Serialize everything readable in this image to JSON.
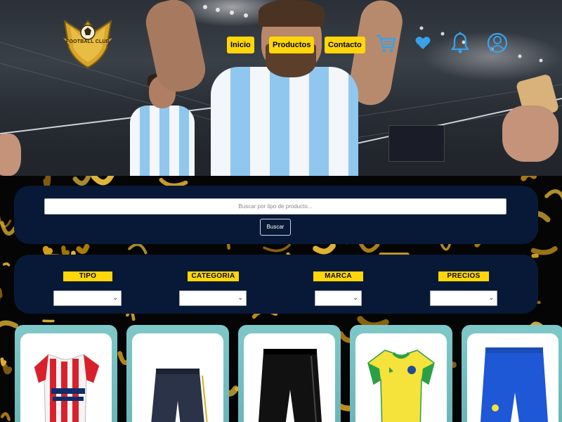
{
  "brand": {
    "logo_text": "FOOTBALL CLUB"
  },
  "nav": {
    "items": [
      {
        "label": "Inicio"
      },
      {
        "label": "Productos"
      },
      {
        "label": "Contacto"
      }
    ],
    "icons": [
      "cart-icon",
      "heart-icon",
      "bell-icon",
      "user-icon"
    ]
  },
  "search": {
    "placeholder": "Buscar por tipo de producto...",
    "button_label": "Buscar"
  },
  "filters": [
    {
      "label": "TIPO",
      "value": ""
    },
    {
      "label": "CATEGORIA",
      "value": ""
    },
    {
      "label": "MARCA",
      "value": ""
    },
    {
      "label": "PRECIOS",
      "value": ""
    }
  ],
  "products": [
    {
      "image": "red-white-striped-jersey"
    },
    {
      "image": "navy-shorts"
    },
    {
      "image": "black-shorts"
    },
    {
      "image": "yellow-brazil-jersey"
    },
    {
      "image": "blue-shorts"
    }
  ],
  "colors": {
    "accent": "#ffd60a",
    "panel": "#071937",
    "card_border": "#7fc8c9",
    "icon_blue": "#3aa0e8"
  }
}
